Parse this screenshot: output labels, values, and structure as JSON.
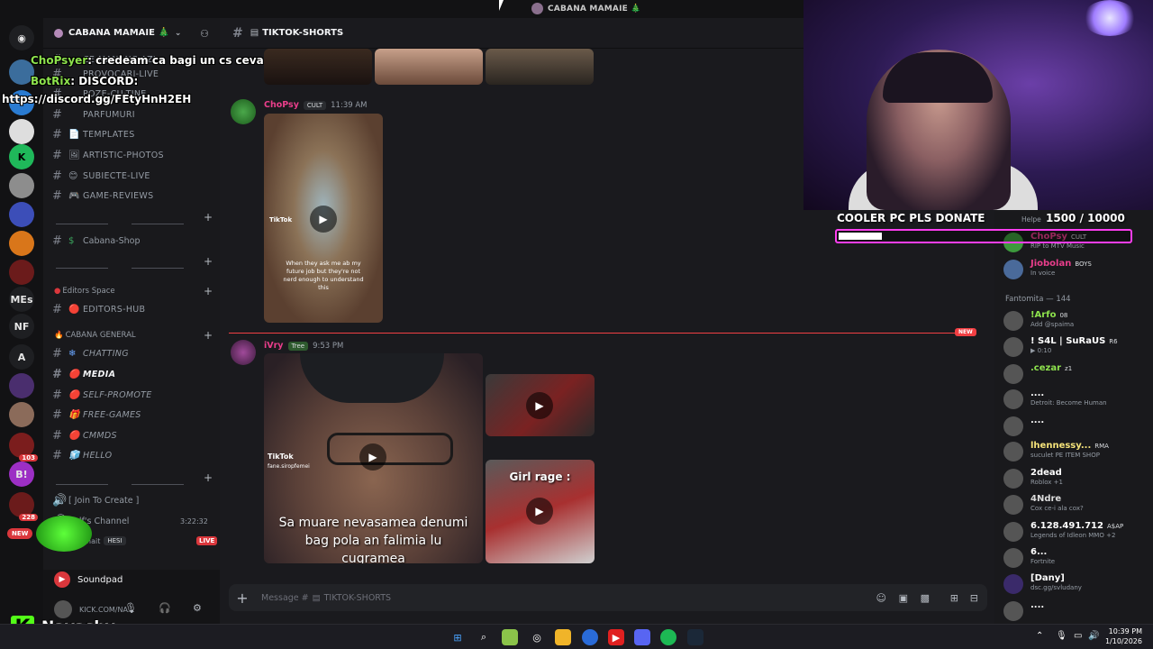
{
  "titlebar": {
    "server_name": "CABANA MAMAIE 🎄"
  },
  "sidebar": {
    "server_name": "CABANA MAMAIE 🎄",
    "channels_top": [
      {
        "name": "CE-MANANC-AZI",
        "emoji": ""
      },
      {
        "name": "PROVOCARI-LIVE",
        "emoji": ""
      },
      {
        "name": "POZE-CU-TINE",
        "emoji": ""
      },
      {
        "name": "PARFUMURI",
        "emoji": ""
      },
      {
        "name": "TEMPLATES",
        "emoji": "📄"
      },
      {
        "name": "ARTISTIC-PHOTOS",
        "emoji": "🖼"
      },
      {
        "name": "SUBIECTE-LIVE",
        "emoji": "😊"
      },
      {
        "name": "GAME-REVIEWS",
        "emoji": "🎮"
      }
    ],
    "shop_channel": {
      "name": "Cabana-Shop",
      "emoji": "$"
    },
    "editors_category": "Editors Space",
    "editors_channel": {
      "name": "EDITORS-HUB",
      "emoji": "🔴"
    },
    "general_category": "CABANA GENERAL",
    "general_channels": [
      {
        "name": "CHATTING",
        "emoji": "❄"
      },
      {
        "name": "MEDIA",
        "emoji": "🔴"
      },
      {
        "name": "SELF-PROMOTE",
        "emoji": "🔴"
      },
      {
        "name": "FREE-GAMES",
        "emoji": "🎁"
      },
      {
        "name": "CMMDS",
        "emoji": "🔴"
      },
      {
        "name": "HELLO",
        "emoji": "🧊"
      }
    ],
    "voice_join": "[ Join To Create ]",
    "voice_channel": "Self's Channel",
    "voice_time": "3:22:32",
    "voice_user": "nait",
    "voice_user_tag": "HESI",
    "live_label": "LIVE",
    "new_label": "NEW",
    "soundpad": "Soundpad",
    "user_status": "KICK.COM/NA..."
  },
  "rail": {
    "labels": [
      "MEs",
      "NF",
      "A"
    ],
    "badges": [
      "103",
      "228"
    ]
  },
  "main": {
    "channel_name": "TIKTOK-SHORTS",
    "msg1": {
      "user": "ChoPsy",
      "tag": "CULT",
      "time": "11:39 AM",
      "video_caption": "When they ask me ab my future job but they're not nerd enough to understand this",
      "tiktok_label": "TikTok"
    },
    "new_badge": "NEW",
    "msg2": {
      "user": "iVry",
      "tag": "Tree",
      "time": "9:53 PM",
      "video_main_caption": "Sa muare nevasamea denumi bag pola an falimia lu cugramea",
      "tiktok_label": "TikTok",
      "tiktok_handle": "fane.siropfemei",
      "video_side_caption": "Girl rage :"
    },
    "composer_placeholder": "Message #",
    "composer_channel": "TIKTOK-SHORTS"
  },
  "members": {
    "helper_label": "Helpe",
    "top_members": [
      {
        "name": "ChoPsy",
        "tag": "CULT",
        "status": "RIP to MTV Music",
        "color": "#e93e8b"
      },
      {
        "name": "Jiobolan",
        "tag": "BOYS",
        "status": "In voice",
        "color": "#e93e8b"
      }
    ],
    "group_label": "Fantomita — 144",
    "list": [
      {
        "name": "!Arfo",
        "tag": "08",
        "status": "Add @spaima",
        "color": "#8ee34d"
      },
      {
        "name": "! S4L | SuRaUS",
        "tag": "R6",
        "status": "▶ 0:10",
        "color": "#ffffff"
      },
      {
        "name": ".cezar",
        "tag": "z1",
        "status": "",
        "color": "#8ee34d"
      },
      {
        "name": "....",
        "tag": "",
        "status": "Detroit: Become Human",
        "color": "#ffffff"
      },
      {
        "name": "....",
        "tag": "",
        "status": "",
        "color": "#ffffff"
      },
      {
        "name": "lhennessy...",
        "tag": "RMA",
        "status": "suculet PE ITEM SHOP",
        "color": "#f5e37a"
      },
      {
        "name": "2dead",
        "tag": "",
        "status": "Roblox +1",
        "color": "#ffffff"
      },
      {
        "name": "4Ndre",
        "tag": "",
        "status": "Cox ce-i ala cox?",
        "color": "#dcdcdc"
      },
      {
        "name": "6.128.491.712",
        "tag": "A$AP",
        "status": "Legends of Idleon MMO +2",
        "color": "#ffffff"
      },
      {
        "name": "6...",
        "tag": "",
        "status": "Fortnite",
        "color": "#ffffff"
      },
      {
        "name": "[Dany]",
        "tag": "",
        "status": "dsc.gg/svludany",
        "color": "#ffffff"
      },
      {
        "name": "....",
        "tag": "",
        "status": "",
        "color": "#ffffff"
      }
    ]
  },
  "stream": {
    "donate_text": "COOLER PC PLS DONATE",
    "goal_text": "1500 / 10000",
    "goal_progress": 0.15,
    "chat": [
      {
        "user": "ChoPsyer",
        "text": ": credeam ca bagi un cs ceva"
      },
      {
        "user": "BotRix",
        "text": ": DISCORD:"
      },
      {
        "user": "",
        "text": "https://discord.gg/FEtyHnH2EH"
      }
    ],
    "kick_name": "Navashy",
    "kick_letter": "K"
  },
  "taskbar": {
    "time": "10:39 PM",
    "date": "1/10/2026"
  },
  "colors": {
    "accent_pink": "#ff3ef0",
    "new_red": "#f23f43",
    "kick_green": "#53fc18"
  }
}
